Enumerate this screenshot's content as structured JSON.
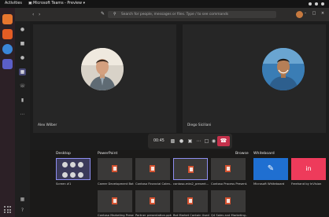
{
  "system_bar": {
    "activities": "Activities",
    "app_name": "▣ Microsoft Teams - Preview ▾"
  },
  "teams": {
    "search_placeholder": "Search for people, messages or files. Type / to see commands",
    "participants": [
      {
        "name": "Alex Wilber"
      },
      {
        "name": "Diego Siciliani"
      }
    ],
    "call": {
      "duration": "00:45"
    },
    "share_tray": {
      "sections": {
        "desktop": "Desktop",
        "powerpoint": "PowerPoint",
        "browse": "Browse",
        "whiteboard": "Whiteboard"
      },
      "desktop_items": [
        {
          "label": "Screen #1"
        }
      ],
      "powerpoint_items": [
        {
          "label": "Career Development Bot..."
        },
        {
          "label": "Contoso Financial Calen..."
        },
        {
          "label": "contoso-mks2_present..."
        },
        {
          "label": "Contoso Process Present..."
        },
        {
          "label": "Contoso Marketing Prese..."
        },
        {
          "label": "Partner presentation.pptx"
        },
        {
          "label": "Bot Market Contain Used..."
        },
        {
          "label": "Q4 Sales and Marketing..."
        }
      ],
      "whiteboard_items": [
        {
          "label": "Microsoft Whiteboard",
          "color": "#1f6fd1",
          "icon": "whiteboard-icon"
        },
        {
          "label": "Freehand by InVision",
          "color": "#ee3b5b",
          "icon": "invision-icon"
        }
      ]
    }
  },
  "colors": {
    "accent": "#464775",
    "hangup": "#c4314b",
    "powerpoint": "#d35230"
  }
}
